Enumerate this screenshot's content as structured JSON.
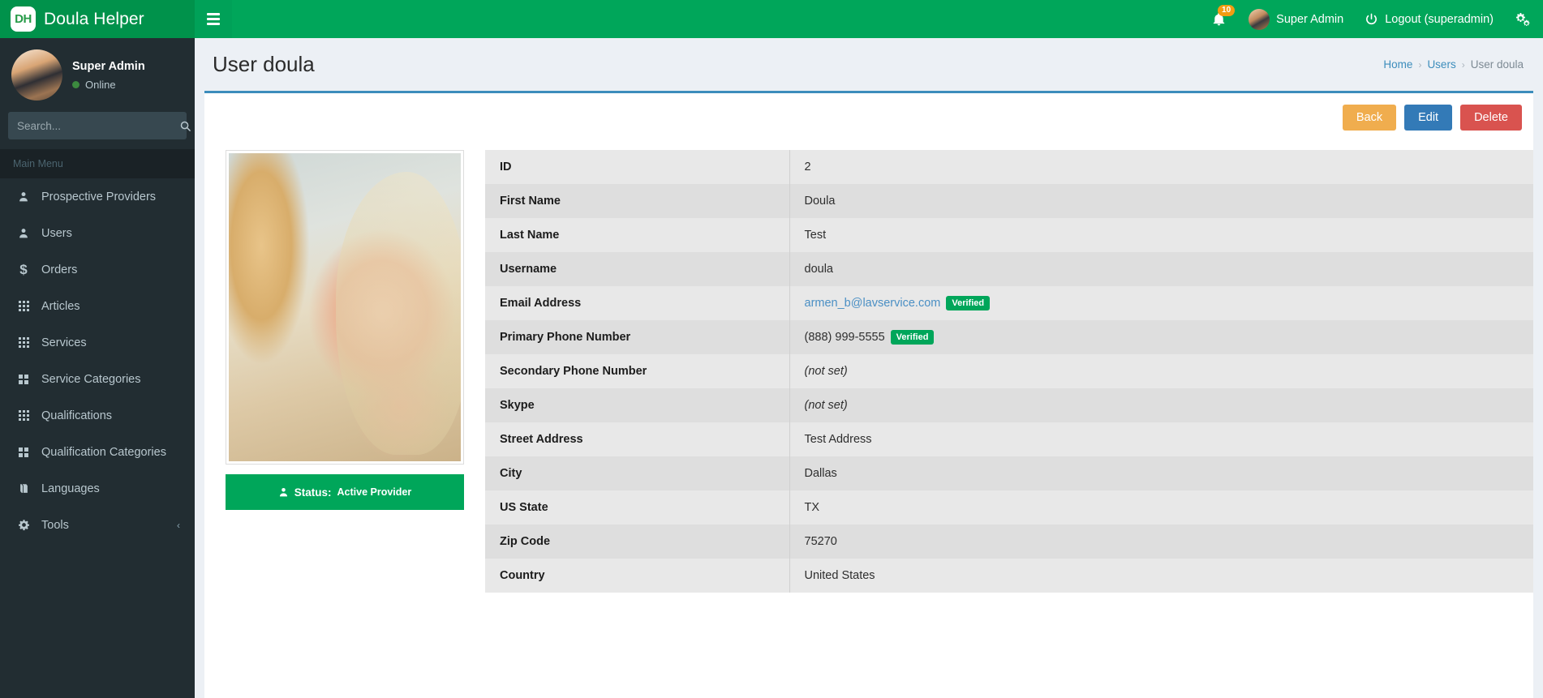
{
  "brand": {
    "logo_initials": "DH",
    "name": "Doula Helper"
  },
  "topbar": {
    "hamburger_icon": "hamburger-icon",
    "notifications": {
      "icon": "bell-icon",
      "count": "10"
    },
    "user": {
      "name": "Super Admin",
      "avatar_icon": "avatar"
    },
    "logout": {
      "icon": "power-icon",
      "label": "Logout (superadmin)"
    },
    "settings_icon": "gears-icon"
  },
  "sidebar": {
    "user_panel": {
      "name": "Super Admin",
      "status": "Online"
    },
    "search": {
      "placeholder": "Search...",
      "value": "",
      "icon": "search-icon"
    },
    "menu_header": "Main Menu",
    "items": [
      {
        "label": "Prospective Providers",
        "icon": "user-icon"
      },
      {
        "label": "Users",
        "icon": "user-icon"
      },
      {
        "label": "Orders",
        "icon": "dollar-icon"
      },
      {
        "label": "Articles",
        "icon": "grid-3x3-icon"
      },
      {
        "label": "Services",
        "icon": "grid-3x3-icon"
      },
      {
        "label": "Service Categories",
        "icon": "grid-2x2-icon"
      },
      {
        "label": "Qualifications",
        "icon": "grid-3x3-icon"
      },
      {
        "label": "Qualification Categories",
        "icon": "grid-2x2-icon"
      },
      {
        "label": "Languages",
        "icon": "book-icon"
      },
      {
        "label": "Tools",
        "icon": "gear-icon",
        "chevron": "‹"
      }
    ]
  },
  "page": {
    "title": "User doula",
    "breadcrumb": [
      {
        "label": "Home",
        "active": false
      },
      {
        "label": "Users",
        "active": false
      },
      {
        "label": "User doula",
        "active": true
      }
    ],
    "separator": "›"
  },
  "actions": {
    "back": "Back",
    "edit": "Edit",
    "delete": "Delete"
  },
  "profile": {
    "photo_alt": "user-photo",
    "status_label": "Status:",
    "status_value": "Active Provider",
    "status_icon": "user-icon"
  },
  "details": {
    "rows": [
      {
        "label": "ID",
        "value": "2",
        "type": "text"
      },
      {
        "label": "First Name",
        "value": "Doula",
        "type": "text"
      },
      {
        "label": "Last Name",
        "value": "Test",
        "type": "text"
      },
      {
        "label": "Username",
        "value": "doula",
        "type": "text"
      },
      {
        "label": "Email Address",
        "value": "armen_b@lavservice.com",
        "type": "link",
        "badge": "Verified"
      },
      {
        "label": "Primary Phone Number",
        "value": "(888) 999-5555",
        "type": "text",
        "badge": "Verified"
      },
      {
        "label": "Secondary Phone Number",
        "value": "(not set)",
        "type": "notset"
      },
      {
        "label": "Skype",
        "value": "(not set)",
        "type": "notset"
      },
      {
        "label": "Street Address",
        "value": "Test Address",
        "type": "text"
      },
      {
        "label": "City",
        "value": "Dallas",
        "type": "text"
      },
      {
        "label": "US State",
        "value": "TX",
        "type": "text"
      },
      {
        "label": "Zip Code",
        "value": "75270",
        "type": "text"
      },
      {
        "label": "Country",
        "value": "United States",
        "type": "text"
      }
    ]
  },
  "colors": {
    "brand_green": "#00a65a",
    "logo_green": "#00924b",
    "sidebar_dark": "#222d32",
    "accent_blue": "#3c8dbc",
    "warning": "#f0ad4e",
    "danger": "#d9534f",
    "badge_orange": "#f39c12"
  }
}
